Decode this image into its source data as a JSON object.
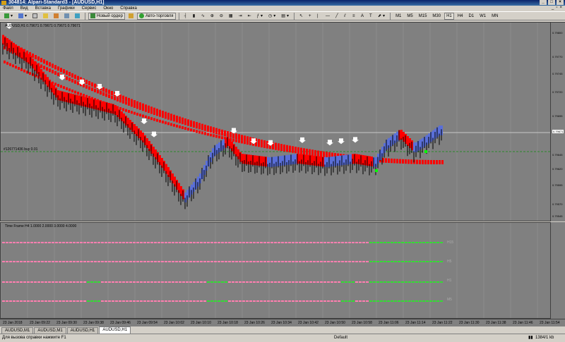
{
  "window": {
    "title": "304814: Alpari-Standard3 - [AUDUSD,H1]"
  },
  "menu": [
    "Файл",
    "Вид",
    "Вставка",
    "Графики",
    "Сервис",
    "Окно",
    "Справка"
  ],
  "toolbar": {
    "new_order": "Новый ордер",
    "auto_trading": "Авто-торговля",
    "timeframes": [
      "M1",
      "M5",
      "M15",
      "M30",
      "H1",
      "H4",
      "D1",
      "W1",
      "MN"
    ]
  },
  "main_chart": {
    "caption": "AUDUSD,H1  0.79671 0.79671 0.79671 0.79671",
    "order_line_label": "#126771436 buy 0.01",
    "price_labels": [
      "0.79800",
      "0.79770",
      "0.79745",
      "0.79720",
      "0.79695",
      "0.79670",
      "0.79645",
      "0.79620",
      "0.79595",
      "0.79570",
      "0.79545"
    ],
    "current_price": "0.79671"
  },
  "indicator": {
    "caption": "Time Frame H4  1.0000 2.0000 3.0000 4.0000",
    "level_labels": [
      "H15",
      "H5",
      "H1",
      "M5"
    ]
  },
  "time_axis": [
    "23 Jan 2018",
    "23 Jan 09:22",
    "23 Jan 09:30",
    "23 Jan 09:38",
    "23 Jan 09:46",
    "23 Jan 09:54",
    "23 Jan 10:02",
    "23 Jan 10:10",
    "23 Jan 10:18",
    "23 Jan 10:26",
    "23 Jan 10:34",
    "23 Jan 10:42",
    "23 Jan 10:50",
    "23 Jan 10:58",
    "23 Jan 11:06",
    "23 Jan 11:14",
    "23 Jan 11:22",
    "23 Jan 11:30",
    "23 Jan 11:38",
    "23 Jan 11:46",
    "23 Jan 11:54"
  ],
  "tabs": [
    "AUDUSD,M1",
    "AUDUSD,M1",
    "AUDUSD,H1",
    "AUDUSD,H1"
  ],
  "active_tab": 3,
  "status": {
    "help": "Для вызова справки нажмите F1",
    "profile": "Default",
    "traffic": "1384/1 kb"
  },
  "colors": {
    "chart_bg": "#808080",
    "bear": "#ff0000",
    "bull": "#5a6fd8",
    "arrow": "#ffffff",
    "pink": "#ff7fb0",
    "green": "#33dd33",
    "signal": "#00ff00"
  }
}
